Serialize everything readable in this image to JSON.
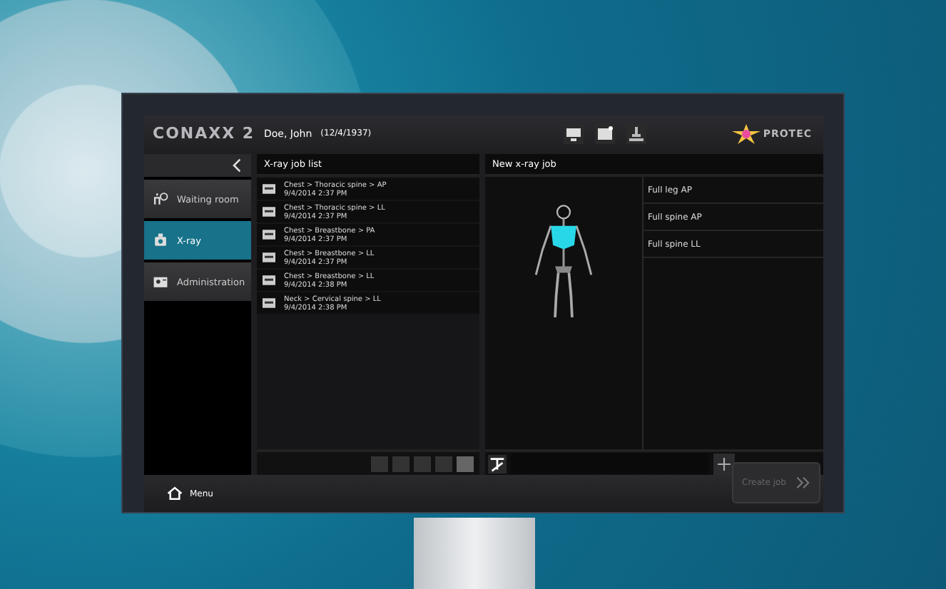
{
  "app": {
    "logo": "CONAXX 2",
    "patient": "Doe, John",
    "birth_date": "(12/4/1937)",
    "brand": "PROTEC"
  },
  "sidebar": {
    "items": [
      {
        "kind": "waiting",
        "label": "Waiting room",
        "selected": false
      },
      {
        "kind": "xray",
        "label": "X-ray",
        "selected": true
      },
      {
        "kind": "admin",
        "label": "Administration",
        "selected": false
      }
    ]
  },
  "job_list": {
    "title": "X-ray job list",
    "jobs": [
      {
        "exam": "Chest > Thoracic spine > AP",
        "time": "9/4/2014 2:37 PM"
      },
      {
        "exam": "Chest > Thoracic spine > LL",
        "time": "9/4/2014 2:37 PM"
      },
      {
        "exam": "Chest > Breastbone > PA",
        "time": "9/4/2014 2:37 PM"
      },
      {
        "exam": "Chest > Breastbone > LL",
        "time": "9/4/2014 2:37 PM"
      },
      {
        "exam": "Chest > Breastbone > LL",
        "time": "9/4/2014 2:38 PM"
      },
      {
        "exam": "Neck > Cervical spine > LL",
        "time": "9/4/2014 2:38 PM"
      }
    ]
  },
  "new_job": {
    "title": "New x-ray job",
    "protocols": [
      {
        "label": "Full leg AP"
      },
      {
        "label": "Full spine AP"
      },
      {
        "label": "Full spine LL"
      }
    ],
    "create_button": {
      "label": "Create job",
      "disabled": true
    }
  },
  "footer": {
    "menu": "Menu"
  }
}
